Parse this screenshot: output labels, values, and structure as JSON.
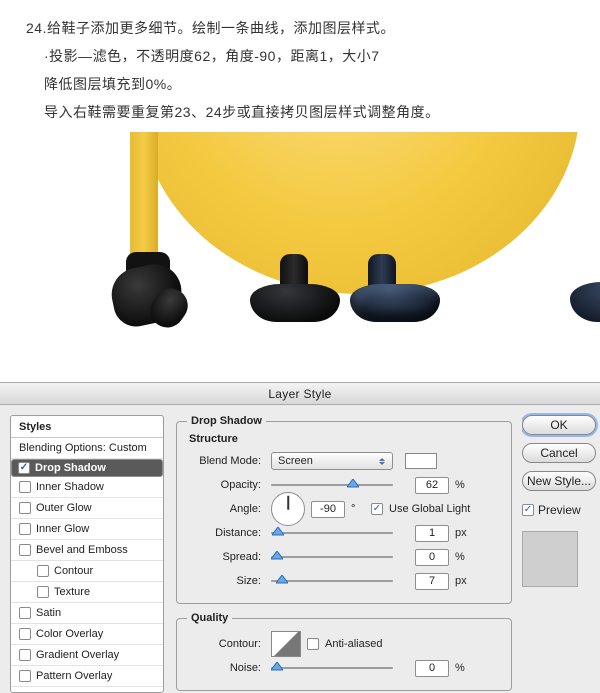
{
  "doc": {
    "line1": "24.给鞋子添加更多细节。绘制一条曲线，添加图层样式。",
    "line2": "·投影—滤色，不透明度62，角度-90，距离1，大小7",
    "line3": "降低图层填充到0%。",
    "line4": "导入右鞋需要重复第23、24步或直接拷贝图层样式调整角度。"
  },
  "dialog": {
    "title": "Layer Style",
    "styles_header": "Styles",
    "blending_label": "Blending Options: Custom",
    "items": [
      {
        "label": "Drop Shadow",
        "checked": true,
        "selected": true
      },
      {
        "label": "Inner Shadow",
        "checked": false
      },
      {
        "label": "Outer Glow",
        "checked": false
      },
      {
        "label": "Inner Glow",
        "checked": false
      },
      {
        "label": "Bevel and Emboss",
        "checked": false
      },
      {
        "label": "Contour",
        "checked": false,
        "inset": true
      },
      {
        "label": "Texture",
        "checked": false,
        "inset": true
      },
      {
        "label": "Satin",
        "checked": false
      },
      {
        "label": "Color Overlay",
        "checked": false
      },
      {
        "label": "Gradient Overlay",
        "checked": false
      },
      {
        "label": "Pattern Overlay",
        "checked": false
      }
    ],
    "group_structure": "Structure",
    "group_quality": "Quality",
    "labels": {
      "blend_mode": "Blend Mode:",
      "opacity": "Opacity:",
      "angle": "Angle:",
      "distance": "Distance:",
      "spread": "Spread:",
      "size": "Size:",
      "contour": "Contour:",
      "noise": "Noise:",
      "use_global": "Use Global Light",
      "anti_aliased": "Anti-aliased"
    },
    "values": {
      "blend_mode": "Screen",
      "swatch_color": "#ffffff",
      "opacity": "62",
      "angle": "-90",
      "distance": "1",
      "spread": "0",
      "size": "7",
      "noise": "0",
      "use_global_checked": true,
      "anti_aliased_checked": false
    },
    "units": {
      "percent": "%",
      "deg": "°",
      "px": "px"
    },
    "buttons": {
      "ok": "OK",
      "cancel": "Cancel",
      "new_style": "New Style..."
    },
    "preview_label": "Preview",
    "preview_checked": true
  }
}
